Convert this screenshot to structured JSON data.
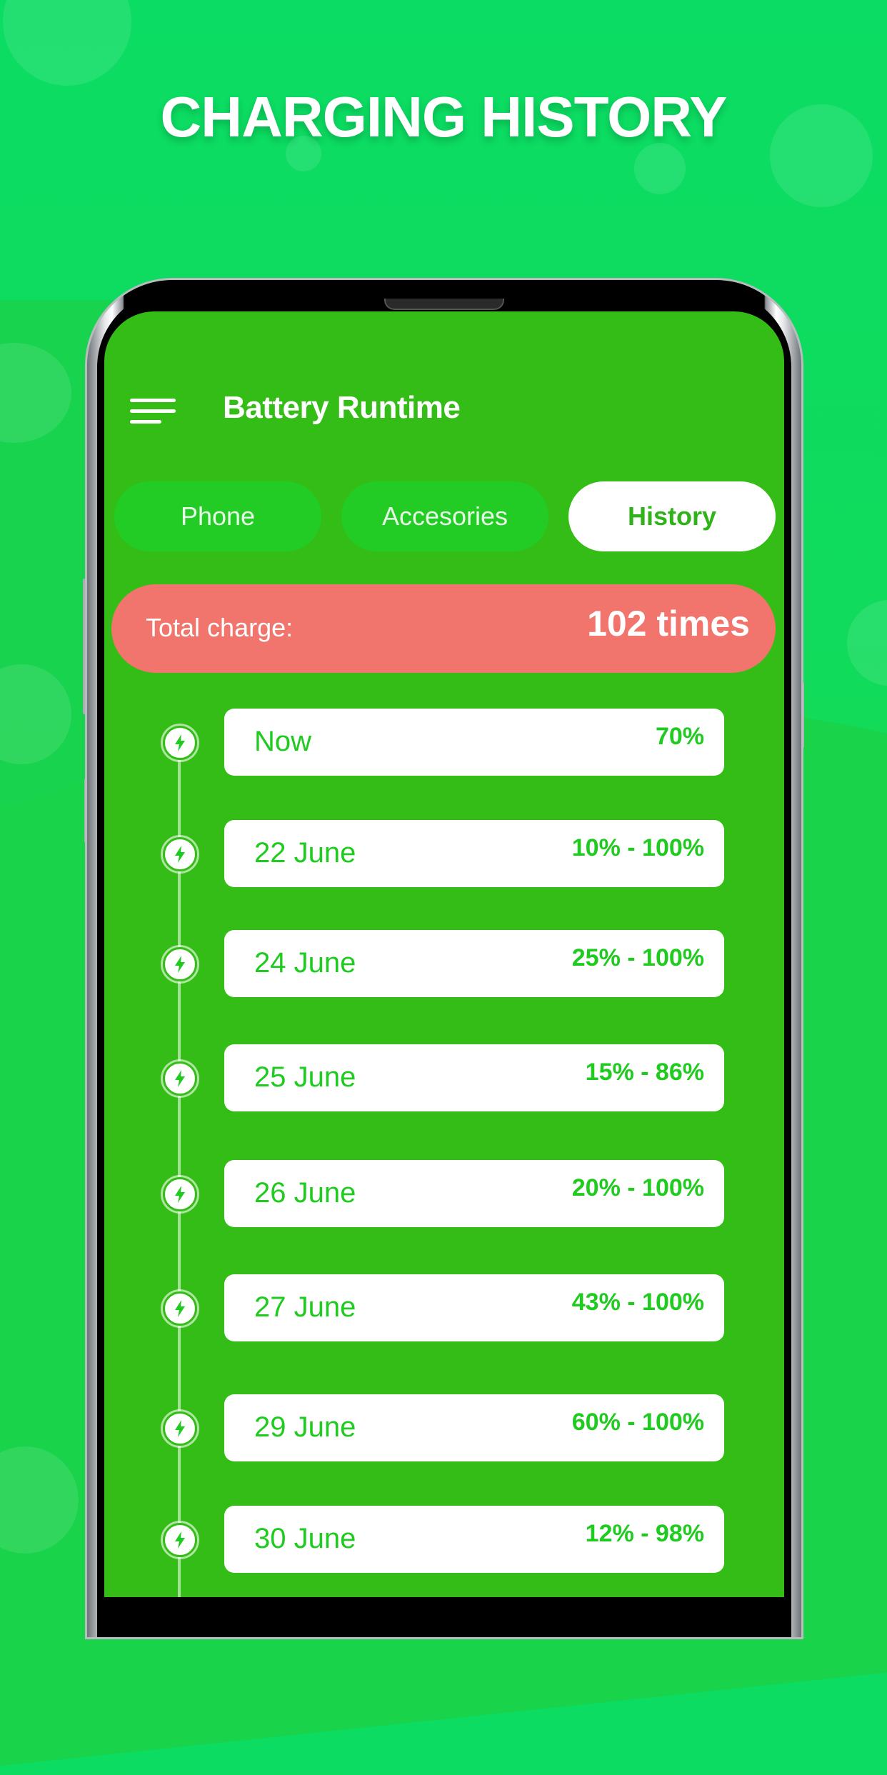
{
  "headline": "CHARGING HISTORY",
  "app": {
    "title": "Battery Runtime",
    "menu_icon": "hamburger-menu-icon"
  },
  "tabs": [
    {
      "label": "Phone",
      "active": false
    },
    {
      "label": "Accesories",
      "active": false
    },
    {
      "label": "History",
      "active": true
    }
  ],
  "summary": {
    "label": "Total charge:",
    "value": "102 times"
  },
  "history": [
    {
      "date": "Now",
      "range": "70%",
      "icon": "lightning-bolt-icon"
    },
    {
      "date": "22 June",
      "range": "10% - 100%",
      "icon": "lightning-bolt-icon"
    },
    {
      "date": "24 June",
      "range": "25% - 100%",
      "icon": "lightning-bolt-icon"
    },
    {
      "date": "25 June",
      "range": "15% - 86%",
      "icon": "lightning-bolt-icon"
    },
    {
      "date": "26 June",
      "range": "20% - 100%",
      "icon": "lightning-bolt-icon"
    },
    {
      "date": "27 June",
      "range": "43% - 100%",
      "icon": "lightning-bolt-icon"
    },
    {
      "date": "29 June",
      "range": "60% - 100%",
      "icon": "lightning-bolt-icon"
    },
    {
      "date": "30 June",
      "range": "12% - 98%",
      "icon": "lightning-bolt-icon"
    }
  ],
  "colors": {
    "background": "#0bdc63",
    "screen": "#33bd16",
    "tab_inactive": "#22cc24",
    "summary_bar": "#f1756d",
    "accent_text": "#1fcb1f"
  }
}
